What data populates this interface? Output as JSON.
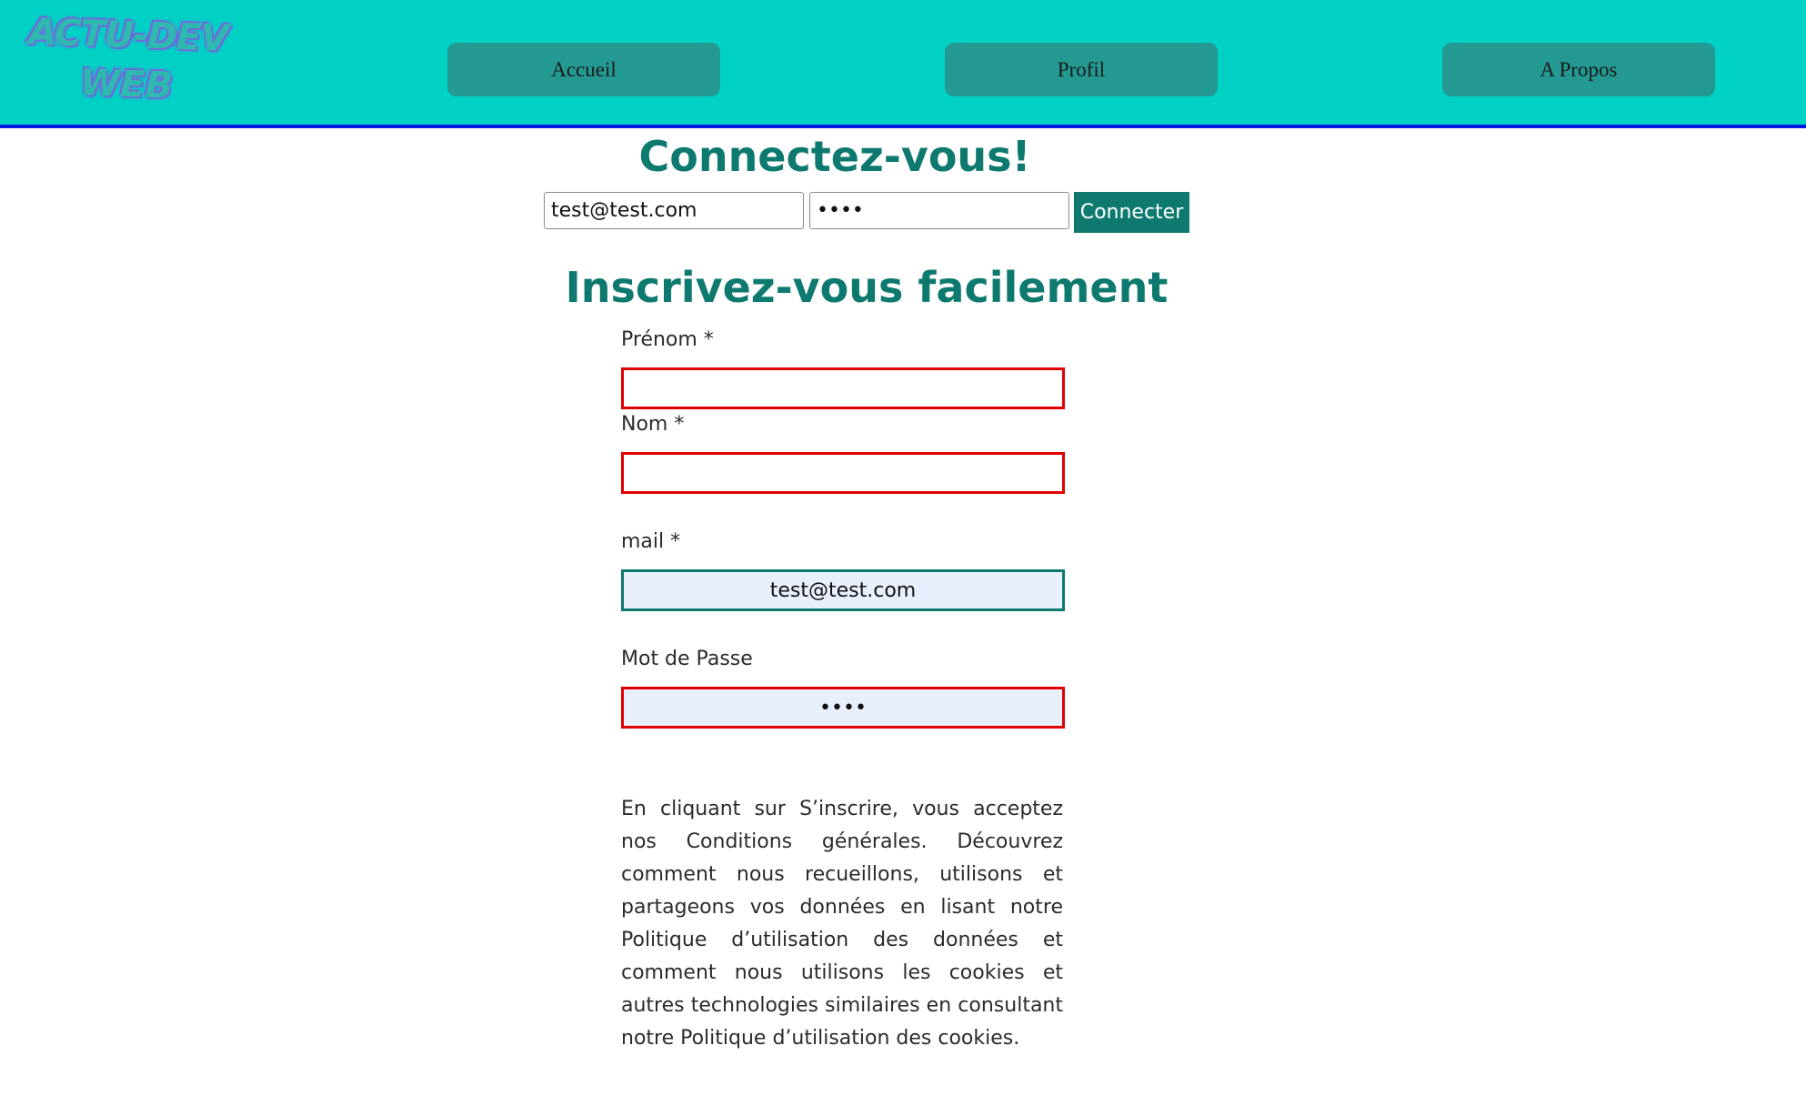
{
  "header": {
    "logo_line1": "ACTU-DEV",
    "logo_line2": "WEB",
    "nav": {
      "home": "Accueil",
      "profile": "Profil",
      "about": "A Propos"
    }
  },
  "login": {
    "title": "Connectez-vous!",
    "email_value": "test@test.com",
    "password_value": "test",
    "button_label": "Connecter"
  },
  "signup": {
    "title": "Inscrivez-vous facilement",
    "fields": {
      "firstname_label": "Prénom *",
      "firstname_value": "",
      "lastname_label": "Nom *",
      "lastname_value": "",
      "mail_label": "mail *",
      "mail_value": "test@test.com",
      "password_label": "Mot de Passe",
      "password_value": "test"
    },
    "terms": "En cliquant sur S’inscrire, vous acceptez nos Conditions générales. Découvrez comment nous recueillons, utilisons et partageons vos données en lisant notre Politique d’utilisation des données et comment nous utilisons les cookies et autres technologies similaires en consultant notre Politique d’utilisation des cookies."
  },
  "colors": {
    "header_bg": "#00d1c5",
    "nav_button_bg": "#239992",
    "accent": "#0e7a6f",
    "error_border": "#e00000",
    "header_border": "#0018e0"
  }
}
